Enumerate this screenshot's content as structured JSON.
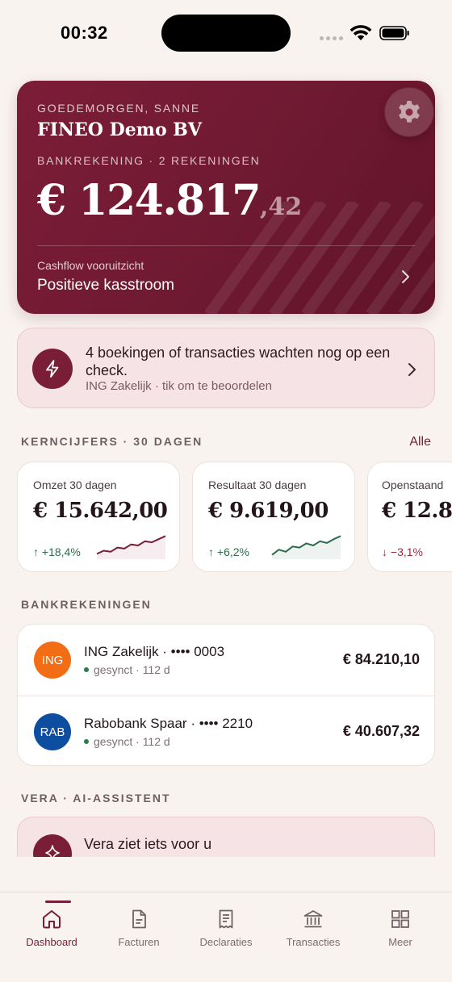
{
  "status_bar": {
    "time": "00:32"
  },
  "hero": {
    "greeting": "GOEDEMORGEN, SANNE",
    "company": "FINEO Demo BV",
    "account_line": "BANKREKENING · 2 REKENINGEN",
    "balance_main": "€ 124.817",
    "balance_cents": ",42",
    "cashflow_label": "Cashflow vooruitzicht",
    "cashflow_value": "Positieve kasstroom"
  },
  "alert": {
    "title": "4 boekingen of transacties wachten nog op een check.",
    "subtitle": "ING Zakelijk · tik om te beoordelen"
  },
  "kpis": {
    "heading": "KERNCIJFERS · 30 DAGEN",
    "link": "Alle",
    "items": [
      {
        "label": "Omzet 30 dagen",
        "value": "€ 15.642,00",
        "delta": "↑ +18,4%",
        "trend": "up",
        "spark_color": "#7a1d36",
        "spark": [
          0.1,
          0.25,
          0.2,
          0.4,
          0.35,
          0.55,
          0.5,
          0.7,
          0.65,
          0.8,
          0.95
        ]
      },
      {
        "label": "Resultaat 30 dagen",
        "value": "€ 9.619,00",
        "delta": "↑ +6,2%",
        "trend": "up",
        "spark_color": "#2c6b4c",
        "spark": [
          0.05,
          0.3,
          0.2,
          0.45,
          0.4,
          0.6,
          0.5,
          0.7,
          0.62,
          0.8,
          0.95
        ]
      },
      {
        "label": "Openstaand",
        "value": "€ 12.8",
        "delta": "↓ −3,1%",
        "trend": "down",
        "spark_color": "#9c2a3c",
        "spark": []
      }
    ]
  },
  "banks": {
    "heading": "BANKREKENINGEN",
    "items": [
      {
        "logo": "ING",
        "logo_color": "#f26d14",
        "name": "ING Zakelijk · •••• 0003",
        "status": "gesynct · 112 d",
        "amount": "€ 84.210,10"
      },
      {
        "logo": "RAB",
        "logo_color": "#0d4ea1",
        "name": "Rabobank Spaar · •••• 2210",
        "status": "gesynct · 112 d",
        "amount": "€ 40.607,32"
      }
    ]
  },
  "vera": {
    "heading": "VERA · AI-ASSISTENT",
    "title": "Vera ziet iets voor u"
  },
  "tabs": [
    {
      "label": "Dashboard",
      "icon": "home-icon",
      "active": true
    },
    {
      "label": "Facturen",
      "icon": "document-icon",
      "active": false
    },
    {
      "label": "Declaraties",
      "icon": "receipt-icon",
      "active": false
    },
    {
      "label": "Transacties",
      "icon": "bank-icon",
      "active": false
    },
    {
      "label": "Meer",
      "icon": "grid-icon",
      "active": false
    }
  ],
  "colors": {
    "accent": "#7a1d36",
    "positive": "#2c6b4c",
    "negative": "#9c2a3c",
    "background": "#f9f3f0"
  }
}
